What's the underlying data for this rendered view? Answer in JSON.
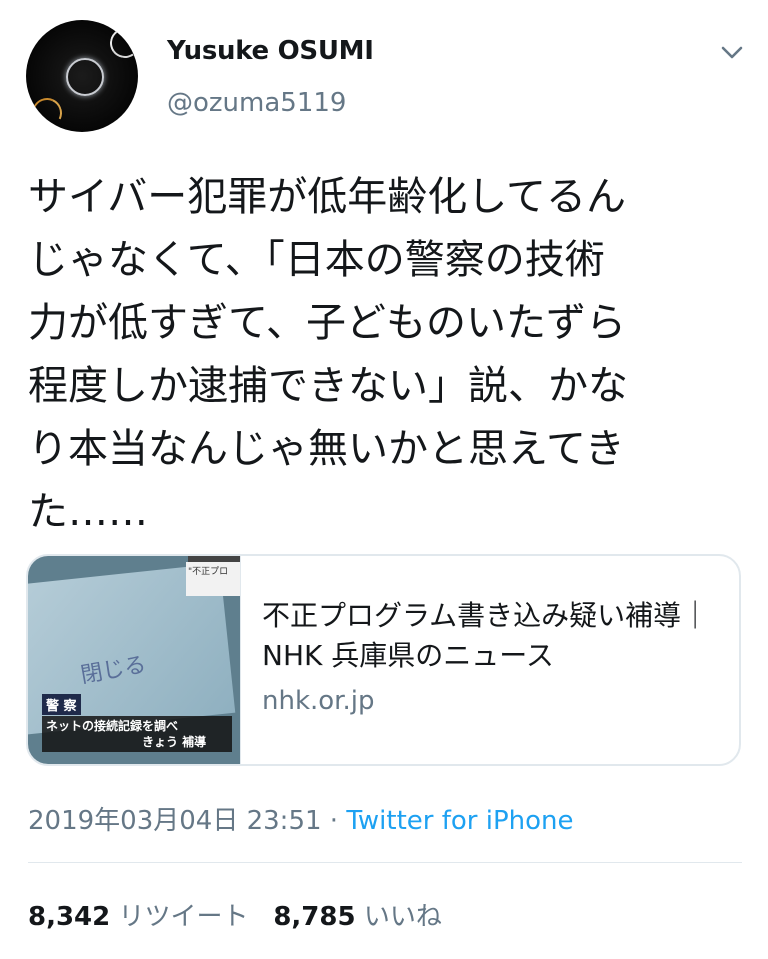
{
  "user": {
    "name": "Yusuke OSUMI",
    "handle": "@ozuma5119"
  },
  "tweet": {
    "text": "サイバー犯罪が低年齢化してるん\nじゃなくて、「日本の警察の技術\n力が低すぎて、子どものいたずら\n程度しか逮捕できない」説、かな\nり本当なんじゃ無いかと思えてき\nた……"
  },
  "card": {
    "title": "不正プログラム書き込み疑い補導｜NHK 兵庫県のニュース",
    "domain": "nhk.or.jp",
    "thumb": {
      "label_top": "\"不正プロ",
      "sign": "閉じる",
      "caption_tag": "警 察",
      "caption_line1": "ネットの接続記録を調べ",
      "caption_line2": "きょう 補導"
    }
  },
  "meta": {
    "datetime": "2019年03月04日 23:51",
    "separator": " · ",
    "source": "Twitter for iPhone"
  },
  "stats": {
    "retweets": "8,342",
    "retweets_label": "リツイート",
    "likes": "8,785",
    "likes_label": "いいね"
  },
  "colors": {
    "link": "#1da1f2",
    "secondary": "#657786",
    "border": "#e1e8ed"
  },
  "icons": {
    "menu": "chevron-down-icon"
  }
}
